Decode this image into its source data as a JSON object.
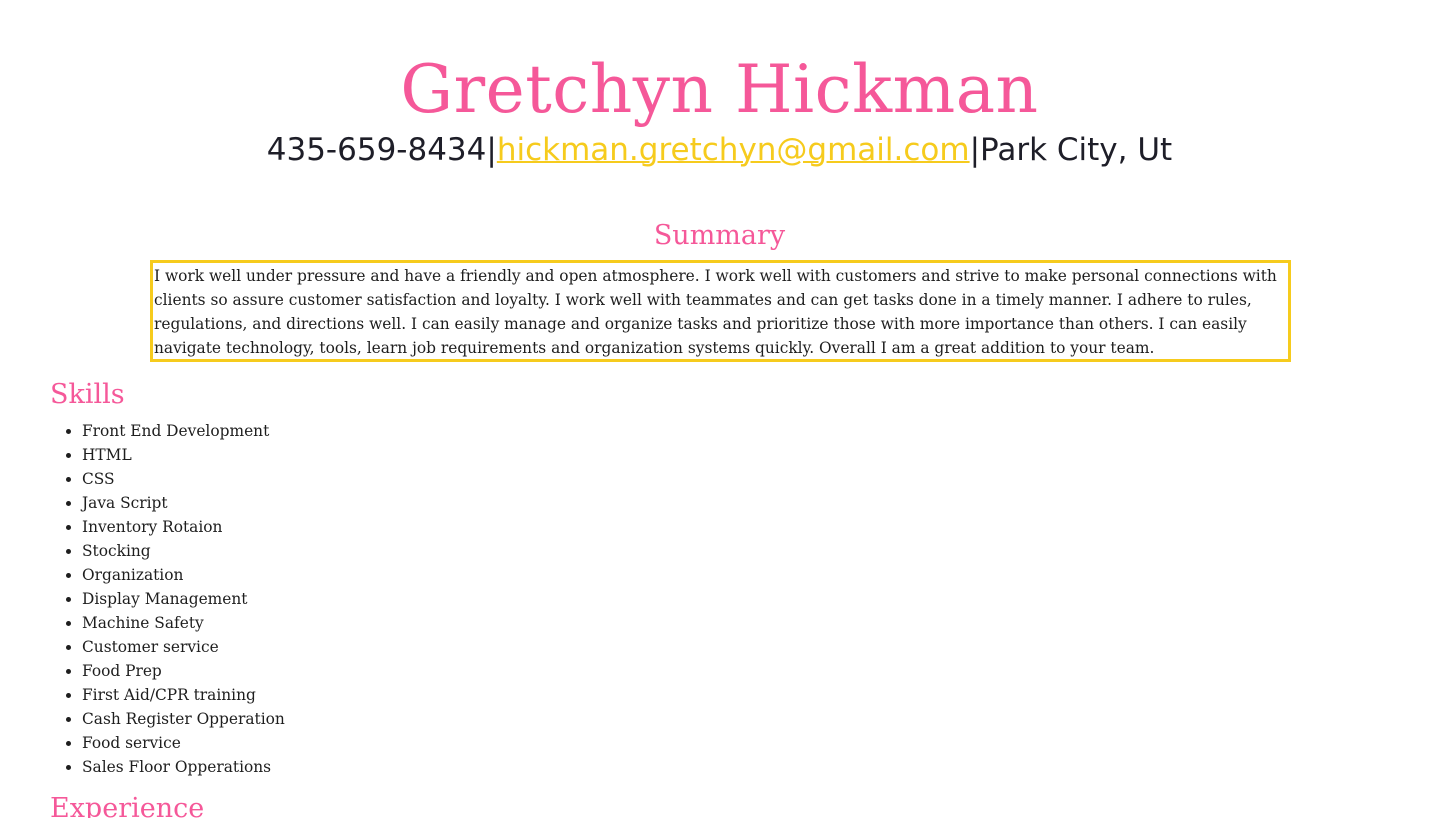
{
  "header": {
    "name": "Gretchyn Hickman",
    "phone": "435-659-8434",
    "separator_1": "|",
    "email": "hickman.gretchyn@gmail.com",
    "separator_2": "|",
    "location": "Park City, Ut"
  },
  "summary": {
    "title": "Summary",
    "text": "I work well under pressure and have a friendly and open atmosphere. I work well with customers and strive to make personal connections with clients so assure customer satisfaction and loyalty. I work well with teammates and can get tasks done in a timely manner. I adhere to rules, regulations, and directions well. I can easily manage and organize tasks and prioritize those with more importance than others. I can easily navigate technology, tools, learn job requirements and organization systems quickly. Overall I am a great addition to your team."
  },
  "skills": {
    "title": "Skills",
    "items": [
      "Front End Development",
      "HTML",
      "CSS",
      "Java Script",
      "Inventory Rotaion",
      "Stocking",
      "Organization",
      "Display Management",
      "Machine Safety",
      "Customer service",
      "Food Prep",
      "First Aid/CPR training",
      "Cash Register Opperation",
      "Food service",
      "Sales Floor Opperations"
    ]
  },
  "experience": {
    "title": "Experience"
  },
  "colors": {
    "heading_pink": "#f55899",
    "accent_yellow": "#f6cb1d",
    "text_dark": "#1e1e28"
  }
}
